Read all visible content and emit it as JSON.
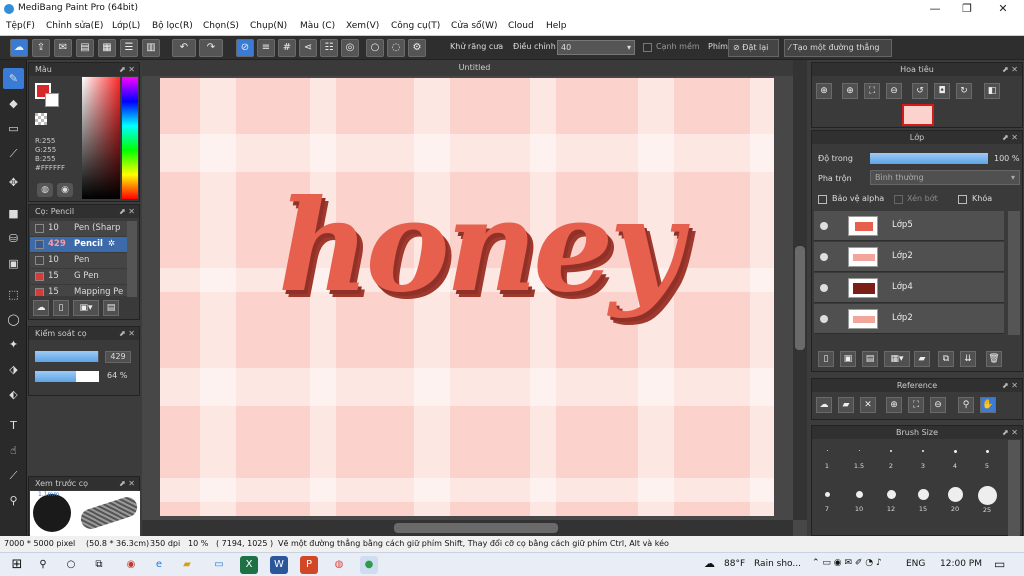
{
  "window": {
    "title": "MediBang Paint Pro (64bit)",
    "min": "—",
    "max": "❐",
    "close": "✕"
  },
  "menu": [
    "Tệp(F)",
    "Chỉnh sửa(E)",
    "Lớp(L)",
    "Bộ lọc(R)",
    "Chọn(S)",
    "Chụp(N)",
    "Màu (C)",
    "Xem(V)",
    "Công cụ(T)",
    "Cửa sổ(W)",
    "Cloud",
    "Help"
  ],
  "toolbar": {
    "antialias": "Khử răng cưa",
    "correction": "Điều chỉnh",
    "correction_value": "40",
    "soft_edge": "Cạnh mềm",
    "key": "Phím",
    "reset": "Đặt lại",
    "make_line": "Tạo một đường thẳng"
  },
  "document": {
    "title": "Untitled",
    "artwork_text": "honey"
  },
  "color_panel": {
    "title": "Màu",
    "r": "R:255",
    "g": "G:255",
    "b": "B:255",
    "hex": "#FFFFFF"
  },
  "brush_panel": {
    "title": "Cọ: Pencil",
    "items": [
      {
        "size": "10",
        "name": "Pen (Sharp",
        "color": "#444444"
      },
      {
        "size": "429",
        "name": "Pencil",
        "color": "#3a5a8c"
      },
      {
        "size": "10",
        "name": "Pen",
        "color": "#444444"
      },
      {
        "size": "15",
        "name": "G Pen",
        "color": "#d63a3a"
      },
      {
        "size": "15",
        "name": "Mapping Pe",
        "color": "#d63a3a"
      }
    ]
  },
  "brush_control": {
    "title": "Kiểm soát cọ",
    "size": "429",
    "opacity": "64 %",
    "size_fill": 0.98,
    "opacity_fill": 0.64
  },
  "preview": {
    "title": "Xem trước cọ",
    "size_label": "1.1mm"
  },
  "navigator": {
    "title": "Hoa tiêu"
  },
  "layers": {
    "title": "Lớp",
    "opacity_label": "Độ trong",
    "opacity_value": "100 %",
    "blend_label": "Pha trộn",
    "blend_value": "Bình thường",
    "protect_alpha": "Bảo vệ alpha",
    "clip": "Xén bớt",
    "lock": "Khóa",
    "items": [
      {
        "name": "Lớp5"
      },
      {
        "name": "Lớp2"
      },
      {
        "name": "Lớp4"
      },
      {
        "name": "Lớp2"
      }
    ]
  },
  "reference": {
    "title": "Reference"
  },
  "brush_size": {
    "title": "Brush Size",
    "row1": [
      "1",
      "1.5",
      "2",
      "3",
      "4",
      "5"
    ],
    "row2": [
      "7",
      "10",
      "12",
      "15",
      "20",
      "25"
    ]
  },
  "status": {
    "dims": "7000 * 5000 pixel",
    "mm": "(50.8 * 36.3cm)",
    "dpi": "350 dpi",
    "zoom": "10 %",
    "coords": "( 7194, 1025 )",
    "hint": "Vẽ một đường thẳng bằng cách giữ phím Shift, Thay đổi cỡ cọ bằng cách giữ phím Ctrl, Alt và kéo"
  },
  "taskbar": {
    "temp": "88°F",
    "weather": "Rain sho...",
    "lang": "ENG",
    "time": "12:00 PM"
  }
}
